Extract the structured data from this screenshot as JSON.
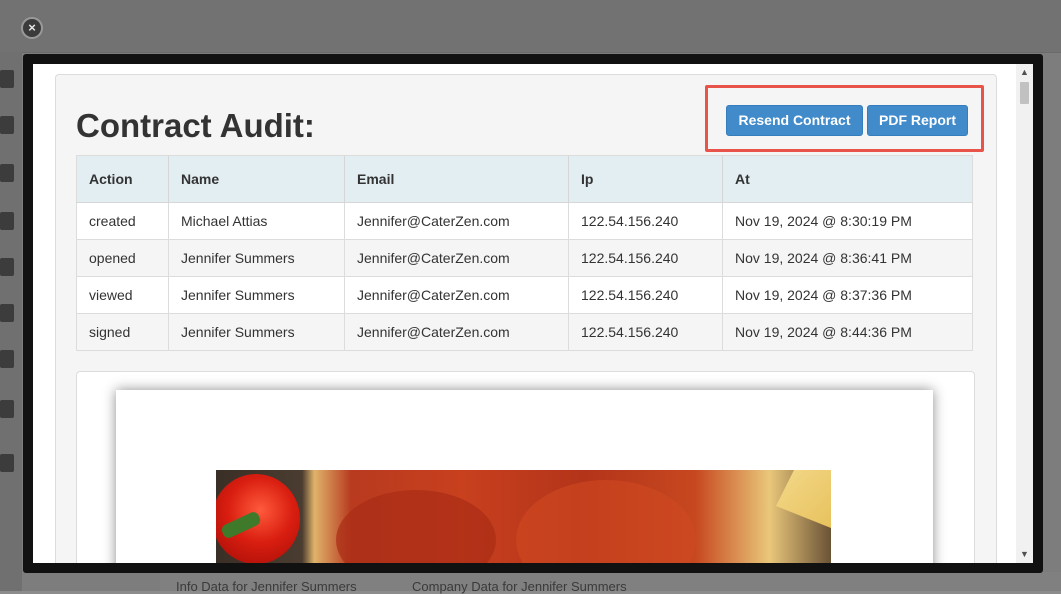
{
  "background": {
    "bottom_tabs": [
      "Info Data for Jennifer Summers",
      "Company Data for Jennifer Summers"
    ]
  },
  "modal": {
    "close_icon": "×",
    "title": "Contract Audit:",
    "buttons": {
      "resend_label": "Resend Contract",
      "pdf_label": "PDF Report"
    },
    "highlight_color": "#e8534a",
    "table": {
      "headers": [
        "Action",
        "Name",
        "Email",
        "Ip",
        "At"
      ],
      "rows": [
        [
          "created",
          "Michael Attias",
          "Jennifer@CaterZen.com",
          "122.54.156.240",
          "Nov 19, 2024 @ 8:30:19 PM"
        ],
        [
          "opened",
          "Jennifer Summers",
          "Jennifer@CaterZen.com",
          "122.54.156.240",
          "Nov 19, 2024 @ 8:36:41 PM"
        ],
        [
          "viewed",
          "Jennifer Summers",
          "Jennifer@CaterZen.com",
          "122.54.156.240",
          "Nov 19, 2024 @ 8:37:36 PM"
        ],
        [
          "signed",
          "Jennifer Summers",
          "Jennifer@CaterZen.com",
          "122.54.156.240",
          "Nov 19, 2024 @ 8:44:36 PM"
        ]
      ]
    },
    "preview": {
      "image": "pizza-with-tomato-sauce-image"
    }
  }
}
